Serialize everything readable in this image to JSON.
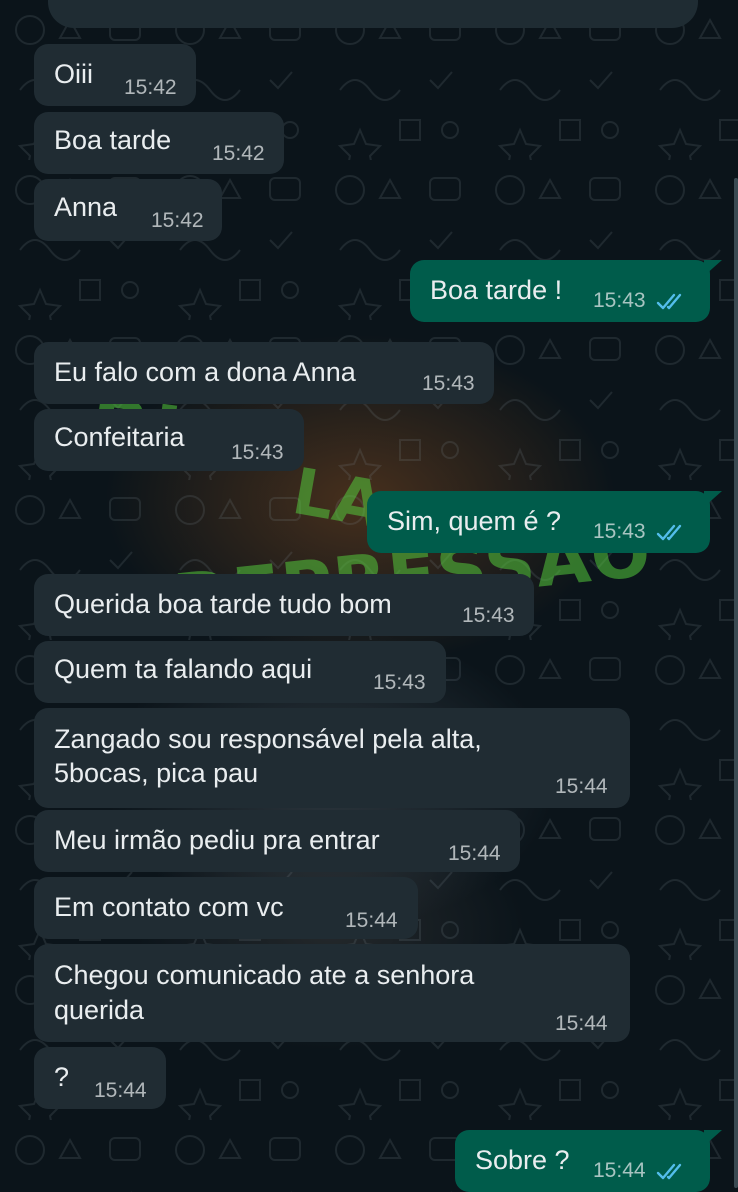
{
  "theme": {
    "incoming_bubble": "#202c33",
    "outgoing_bubble": "#005c4b",
    "read_tick_color": "#53bdeb",
    "background": "#0b141a"
  },
  "wallpaper_overlay": {
    "line1": "RIO",
    "line2": "LA",
    "line3": "DEPRESSÃO"
  },
  "messages": [
    {
      "direction": "incoming",
      "text": "Oiii",
      "time": "15:42"
    },
    {
      "direction": "incoming",
      "text": "Boa tarde",
      "time": "15:42"
    },
    {
      "direction": "incoming",
      "text": "Anna",
      "time": "15:42"
    },
    {
      "direction": "outgoing",
      "text": "Boa tarde !",
      "time": "15:43",
      "status": "read"
    },
    {
      "direction": "incoming",
      "text": "Eu falo com a dona Anna",
      "time": "15:43"
    },
    {
      "direction": "incoming",
      "text": "Confeitaria",
      "time": "15:43"
    },
    {
      "direction": "outgoing",
      "text": "Sim, quem é ?",
      "time": "15:43",
      "status": "read"
    },
    {
      "direction": "incoming",
      "text": "Querida boa tarde tudo bom",
      "time": "15:43"
    },
    {
      "direction": "incoming",
      "text": "Quem ta falando aqui",
      "time": "15:43"
    },
    {
      "direction": "incoming",
      "text_lines": [
        "Zangado sou responsável pela alta,",
        "5bocas, pica pau"
      ],
      "time": "15:44"
    },
    {
      "direction": "incoming",
      "text": "Meu irmão pediu pra entrar",
      "time": "15:44"
    },
    {
      "direction": "incoming",
      "text": "Em contato com vc",
      "time": "15:44"
    },
    {
      "direction": "incoming",
      "text_lines": [
        "Chegou comunicado ate a senhora",
        "querida"
      ],
      "time": "15:44"
    },
    {
      "direction": "incoming",
      "text": "?",
      "time": "15:44"
    },
    {
      "direction": "outgoing",
      "text": "Sobre ?",
      "time": "15:44",
      "status": "read"
    }
  ]
}
